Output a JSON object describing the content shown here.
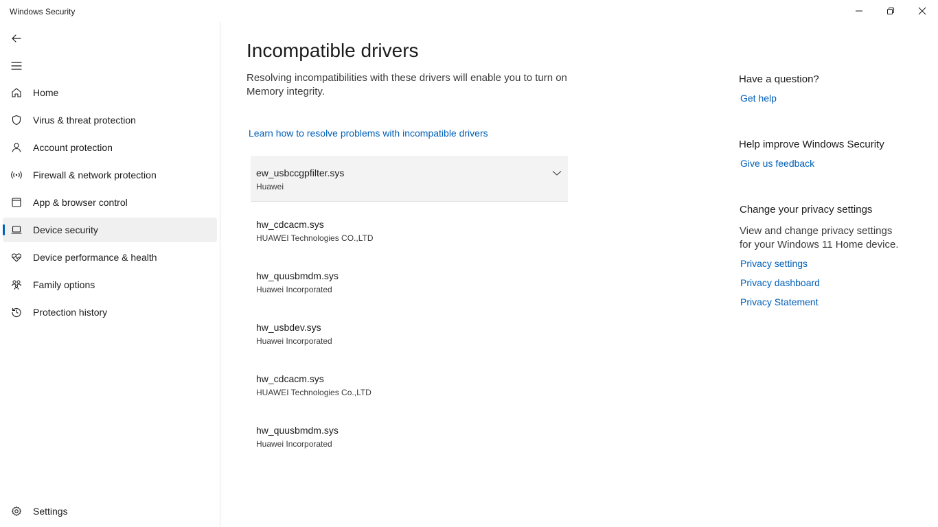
{
  "window": {
    "title": "Windows Security",
    "controls": {
      "minimize": "minimize-icon",
      "restore": "restore-icon",
      "close": "close-icon"
    }
  },
  "sidebar": {
    "back_icon": "back-arrow-icon",
    "menu_icon": "hamburger-icon",
    "items": [
      {
        "label": "Home",
        "icon": "home-icon"
      },
      {
        "label": "Virus & threat protection",
        "icon": "shield-icon"
      },
      {
        "label": "Account protection",
        "icon": "person-icon"
      },
      {
        "label": "Firewall & network protection",
        "icon": "wireless-icon"
      },
      {
        "label": "App & browser control",
        "icon": "app-window-icon"
      },
      {
        "label": "Device security",
        "icon": "laptop-icon",
        "selected": true
      },
      {
        "label": "Device performance & health",
        "icon": "heart-pulse-icon"
      },
      {
        "label": "Family options",
        "icon": "family-icon"
      },
      {
        "label": "Protection history",
        "icon": "history-icon"
      }
    ],
    "settings_label": "Settings",
    "selected_accent": "#005fb8"
  },
  "main": {
    "title": "Incompatible drivers",
    "description": "Resolving incompatibilities with these drivers will enable you to turn on Memory integrity.",
    "learn_link": "Learn how to resolve problems with incompatible drivers",
    "drivers": [
      {
        "name": "ew_usbccgpfilter.sys",
        "vendor": "Huawei",
        "expanded": true
      },
      {
        "name": "hw_cdcacm.sys",
        "vendor": "HUAWEI Technologies CO.,LTD"
      },
      {
        "name": "hw_quusbmdm.sys",
        "vendor": "Huawei Incorporated"
      },
      {
        "name": "hw_usbdev.sys",
        "vendor": "Huawei Incorporated"
      },
      {
        "name": "hw_cdcacm.sys",
        "vendor": "HUAWEI Technologies Co.,LTD"
      },
      {
        "name": "hw_quusbmdm.sys",
        "vendor": "Huawei Incorporated"
      }
    ]
  },
  "aside": {
    "question_heading": "Have a question?",
    "get_help": "Get help",
    "improve_heading": "Help improve Windows Security",
    "feedback": "Give us feedback",
    "privacy_heading": "Change your privacy settings",
    "privacy_desc": "View and change privacy settings for your Windows 11 Home device.",
    "privacy_settings": "Privacy settings",
    "privacy_dashboard": "Privacy dashboard",
    "privacy_statement": "Privacy Statement"
  },
  "colors": {
    "link": "#005fb8",
    "selected_bg": "#f0f0f0",
    "expanded_bg": "#f3f3f3"
  }
}
